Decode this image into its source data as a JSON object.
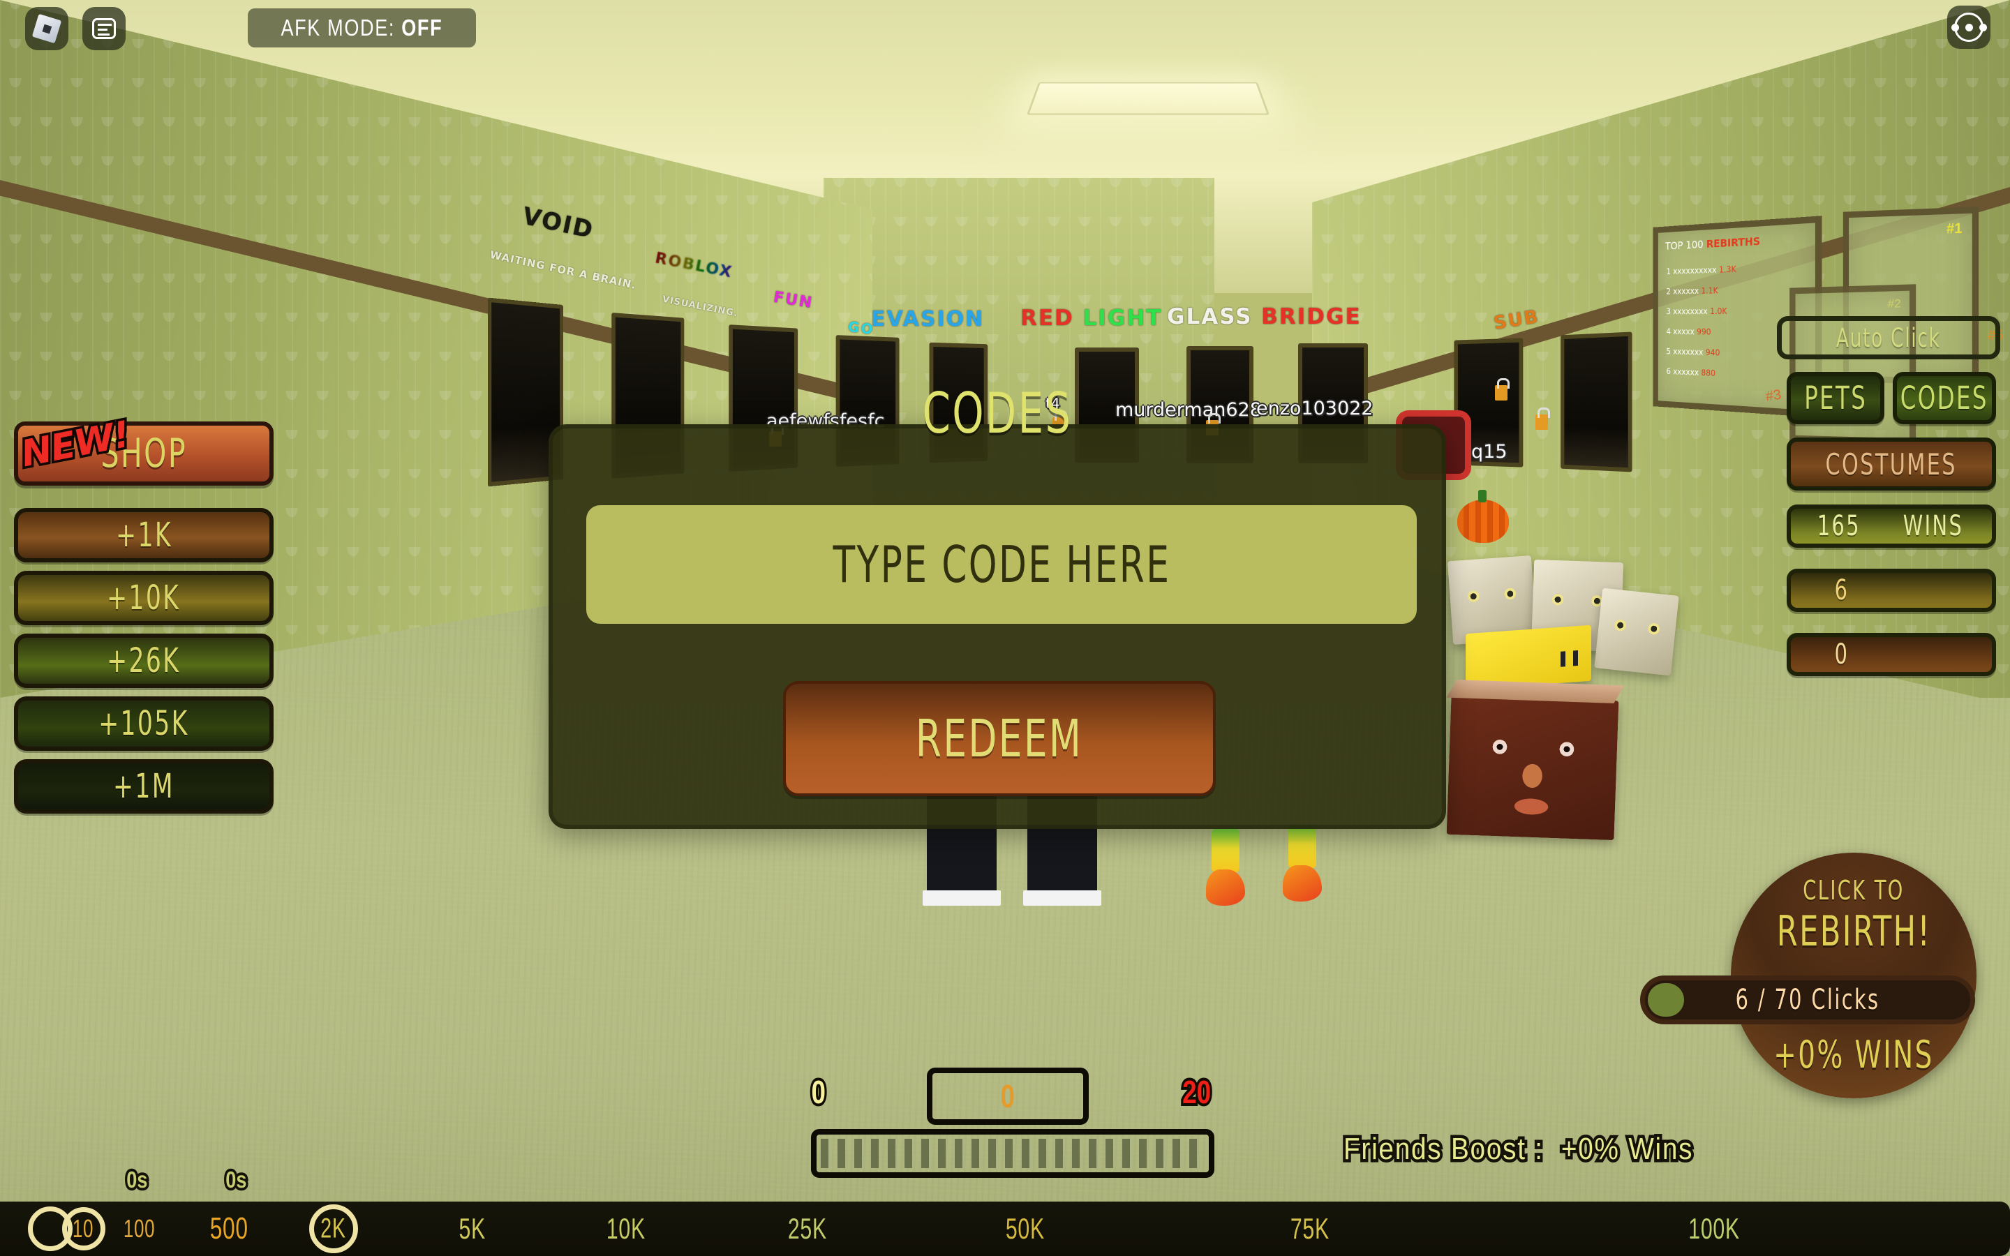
{
  "topbar": {
    "roblox_icon": "roblox-logo-icon",
    "chat_icon": "chat-bubble-icon",
    "menu_icon": "ellipsis-icon",
    "afk_label": "AFK MODE:",
    "afk_value": "OFF"
  },
  "left_panel": {
    "new_badge": "NEW!",
    "shop_label": "SHOP",
    "gain_buttons": [
      {
        "label": "+1K"
      },
      {
        "label": "+10K"
      },
      {
        "label": "+26K"
      },
      {
        "label": "+105K"
      },
      {
        "label": "+1M"
      }
    ]
  },
  "right_panel": {
    "auto_click_label": "Auto Click",
    "pets_label": "PETS",
    "codes_label": "CODES",
    "costumes_label": "COSTUMES",
    "wins_value": "165",
    "wins_label": "WINS",
    "stat_second": "6",
    "stat_third": "0"
  },
  "rebirth": {
    "click_to": "CLICK TO",
    "title": "REBIRTH!",
    "progress_label": "6 / 70 Clicks",
    "progress_current": 6,
    "progress_max": 70,
    "bonus": "+0% WINS"
  },
  "combo_meter": {
    "min": "0",
    "current": "0",
    "max": "20"
  },
  "bottom_bar": {
    "friends_boost_label": "Friends Boost :",
    "friends_boost_value": "+0% Wins",
    "timers": [
      {
        "label": "0s"
      },
      {
        "label": "0s"
      }
    ],
    "milestones": [
      {
        "label": "10",
        "circled": true,
        "color": "#e0a83c"
      },
      {
        "label": "100",
        "circled": false,
        "color": "#e0a83c"
      },
      {
        "label": "500",
        "circled": false,
        "color": "#e8a526"
      },
      {
        "label": "2K",
        "circled": true,
        "color": "#d6c64e"
      },
      {
        "label": "5K",
        "circled": false,
        "color": "#cfca5c"
      },
      {
        "label": "10K",
        "circled": false,
        "color": "#c7cc63"
      },
      {
        "label": "25K",
        "circled": false,
        "color": "#c2cb6b"
      },
      {
        "label": "50K",
        "circled": false,
        "color": "#d6bb3f"
      },
      {
        "label": "75K",
        "circled": false,
        "color": "#d4c04a"
      },
      {
        "label": "100K",
        "circled": false,
        "color": "#bccf6d"
      }
    ]
  },
  "codes_modal": {
    "title": "CODES",
    "input_placeholder": "TYPE CODE HERE",
    "input_value": "",
    "redeem_label": "REDEEM"
  },
  "scene": {
    "door_signs": [
      {
        "text": "VOID",
        "color": "#191a10"
      },
      {
        "text": "EVASION",
        "color": "#2aa6e8"
      },
      {
        "text": "RED LIGHT",
        "color": "#e43226"
      },
      {
        "text": "GLASS BRIDGE",
        "color": "#f2f2ea"
      }
    ],
    "sign_subs": [
      {
        "text": "WAITING FOR A BRAIN."
      },
      {
        "text": "VISUALIZING."
      }
    ],
    "leaderboard_title": "TOP 100 REBIRTHS",
    "player_names": [
      {
        "name": "aefewfsfesfc"
      },
      {
        "name": "t4"
      },
      {
        "name": "murderman628"
      },
      {
        "name": "enzo103022"
      },
      {
        "name": "q15"
      }
    ],
    "board_markers": [
      "#1",
      "#2",
      "#3",
      "#5"
    ]
  },
  "colors": {
    "accent_yellow": "#dfe26d",
    "accent_orange": "#b4512a",
    "danger_red": "#ef2b26",
    "panel_dark": "#303311",
    "wall_green": "#b4bf72"
  }
}
